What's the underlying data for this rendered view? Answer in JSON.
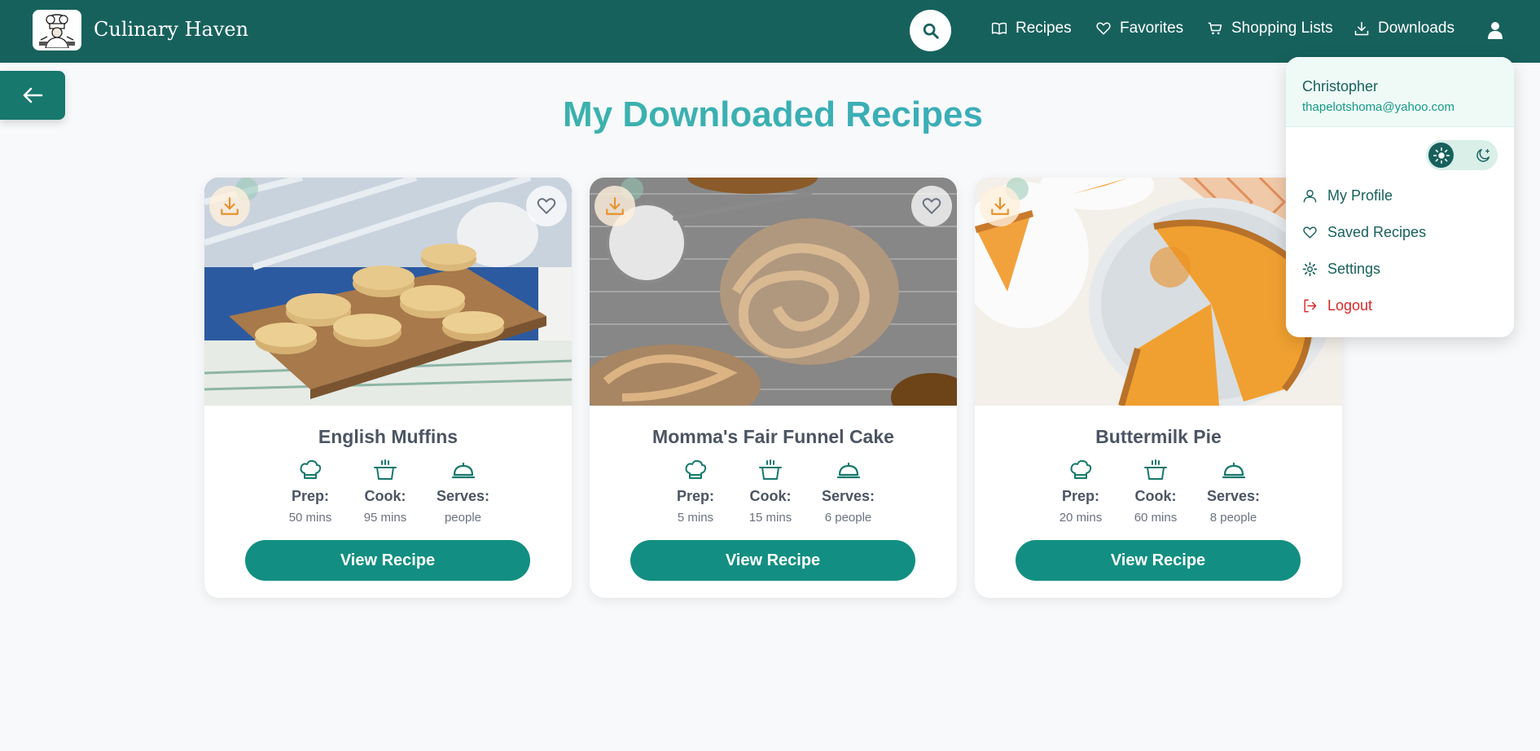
{
  "app": {
    "brand": "Culinary Haven"
  },
  "nav": {
    "items": [
      {
        "label": "Recipes",
        "icon": "book-icon"
      },
      {
        "label": "Favorites",
        "icon": "heart-icon"
      },
      {
        "label": "Shopping Lists",
        "icon": "cart-icon"
      },
      {
        "label": "Downloads",
        "icon": "download-icon"
      }
    ]
  },
  "page": {
    "title": "My Downloaded Recipes"
  },
  "recipes": [
    {
      "title": "English Muffins",
      "prep_label": "Prep:",
      "prep": "50 mins",
      "cook_label": "Cook:",
      "cook": "95 mins",
      "serves_label": "Serves:",
      "serves": "people",
      "button": "View Recipe"
    },
    {
      "title": "Momma's Fair Funnel Cake",
      "prep_label": "Prep:",
      "prep": "5 mins",
      "cook_label": "Cook:",
      "cook": "15 mins",
      "serves_label": "Serves:",
      "serves": "6 people",
      "button": "View Recipe"
    },
    {
      "title": "Buttermilk Pie",
      "prep_label": "Prep:",
      "prep": "20 mins",
      "cook_label": "Cook:",
      "cook": "60 mins",
      "serves_label": "Serves:",
      "serves": "8 people",
      "button": "View Recipe"
    }
  ],
  "user_menu": {
    "name": "Christopher",
    "email": "thapelotshoma@yahoo.com",
    "items": [
      {
        "label": "My Profile",
        "icon": "user-icon"
      },
      {
        "label": "Saved Recipes",
        "icon": "heart-icon"
      },
      {
        "label": "Settings",
        "icon": "gear-icon"
      },
      {
        "label": "Logout",
        "icon": "logout-icon"
      }
    ]
  },
  "colors": {
    "header": "#17615c",
    "accent": "#128f82",
    "download_icon": "#e8922e",
    "logout": "#dc2626"
  }
}
